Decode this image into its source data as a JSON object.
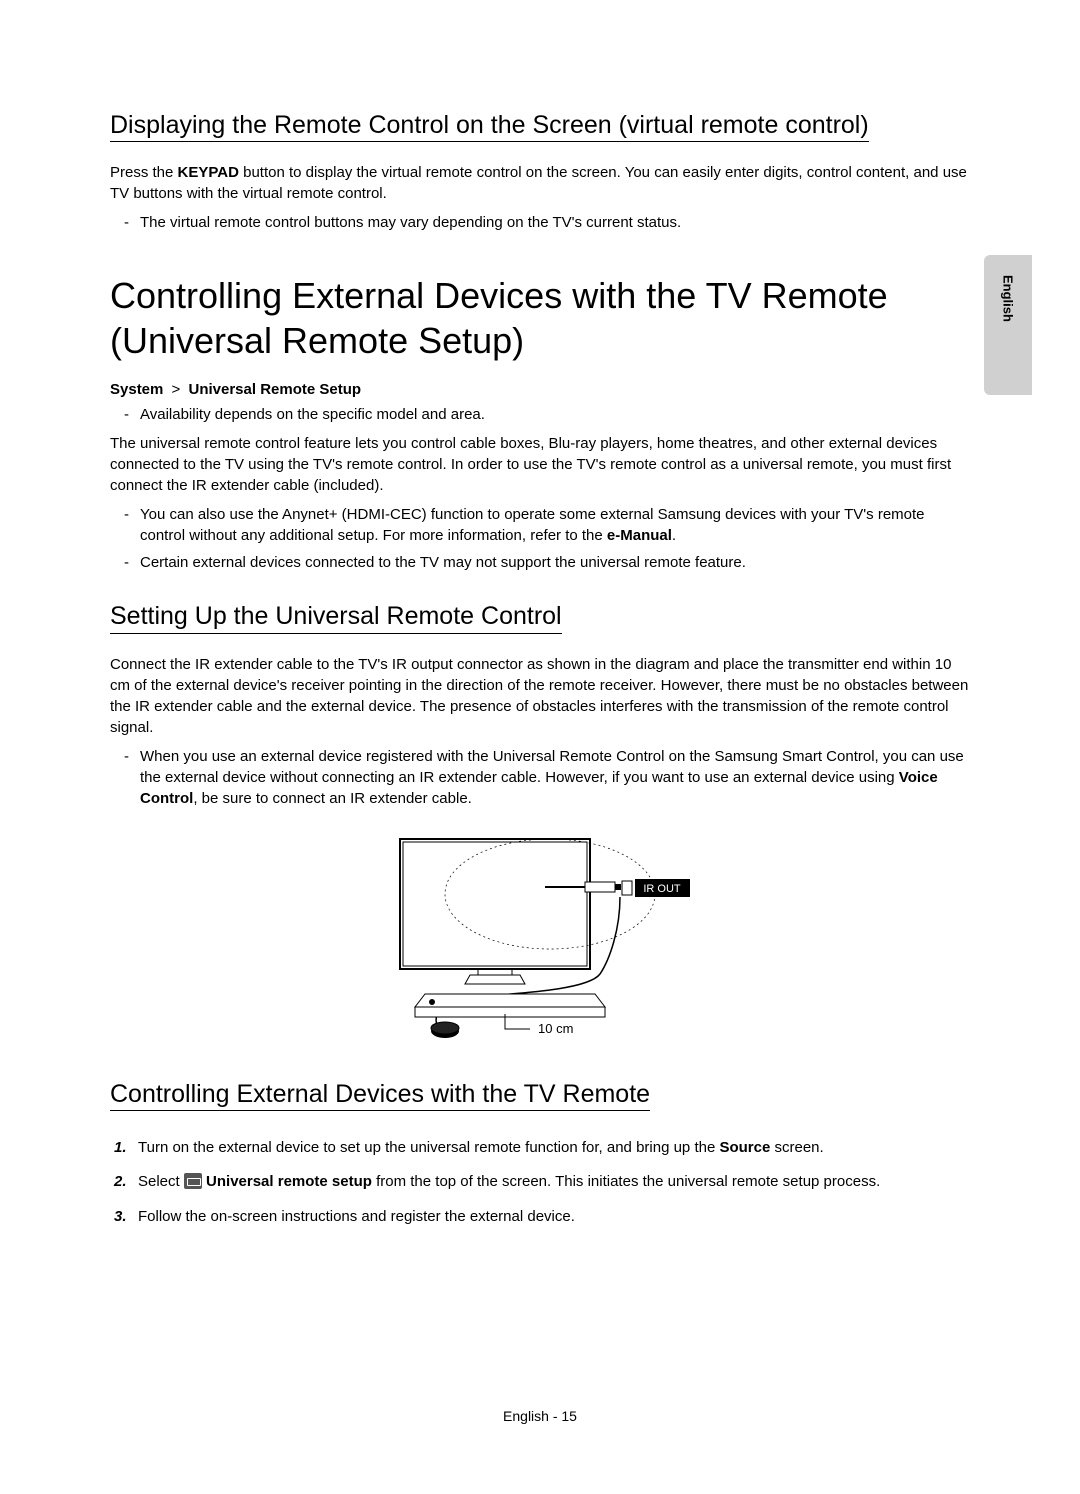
{
  "sideTab": "English",
  "section1": {
    "heading": "Displaying the Remote Control on the Screen (virtual remote control)",
    "p1_a": "Press the ",
    "p1_bold": "KEYPAD",
    "p1_b": " button to display the virtual remote control on the screen. You can easily enter digits, control content, and use TV buttons with the virtual remote control.",
    "bullet1": "The virtual remote control buttons may vary depending on the TV's current status."
  },
  "section2": {
    "heading": "Controlling External Devices with the TV Remote (Universal Remote Setup)",
    "nav_a": "System",
    "nav_sep": ">",
    "nav_b": "Universal Remote Setup",
    "bullet1": "Availability depends on the specific model and area.",
    "p1": "The universal remote control feature lets you control cable boxes, Blu-ray players, home theatres, and other external devices connected to the TV using the TV's remote control. In order to use the TV's remote control as a universal remote, you must first connect the IR extender cable (included).",
    "bullet2_a": "You can also use the Anynet+ (HDMI-CEC) function to operate some external Samsung devices with your TV's remote control without any additional setup. For more information, refer to the ",
    "bullet2_bold": "e-Manual",
    "bullet2_b": ".",
    "bullet3": "Certain external devices connected to the TV may not support the universal remote feature."
  },
  "section3": {
    "heading": "Setting Up the Universal Remote Control",
    "p1": "Connect the IR extender cable to the TV's IR output connector as shown in the diagram and place the transmitter end within 10 cm of the external device's receiver pointing in the direction of the remote receiver. However, there must be no obstacles between the IR extender cable and the external device. The presence of obstacles interferes with the transmission of the remote control signal.",
    "bullet1_a": "When you use an external device registered with the Universal Remote Control on the Samsung Smart Control, you can use the external device without connecting an IR extender cable. However, if you want to use an external device using ",
    "bullet1_bold": "Voice Control",
    "bullet1_b": ", be sure to connect an IR extender cable.",
    "diagram": {
      "ir_out_label": "IR OUT",
      "distance_label": "10 cm"
    }
  },
  "section4": {
    "heading": "Controlling External Devices with the TV Remote",
    "step1_a": "Turn on the external device to set up the universal remote function for, and bring up the ",
    "step1_bold": "Source",
    "step1_b": " screen.",
    "step2_a": "Select ",
    "step2_bold": " Universal remote setup",
    "step2_b": " from the top of the screen. This initiates the universal remote setup process.",
    "step3": "Follow the on-screen instructions and register the external device."
  },
  "footer": "English - 15"
}
